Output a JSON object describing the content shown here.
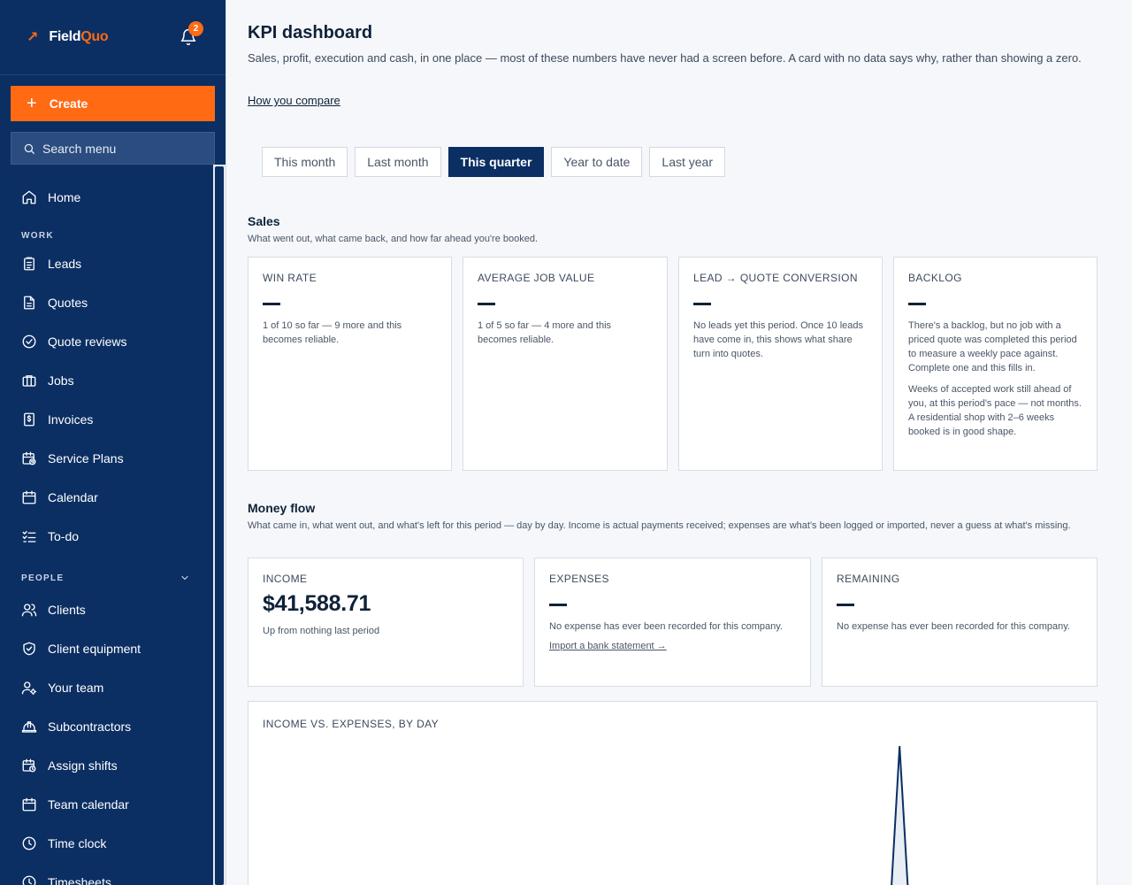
{
  "brand": {
    "name_part1": "Field",
    "name_part2": "Quo",
    "accent": "#ff6a13",
    "sidebar_bg": "#0b2f63"
  },
  "notifications": {
    "count": "2"
  },
  "sidebar": {
    "create_label": "Create",
    "search_label": "Search menu",
    "home": "Home",
    "work_label": "WORK",
    "work_items": [
      "Leads",
      "Quotes",
      "Quote reviews",
      "Jobs",
      "Invoices",
      "Service Plans",
      "Calendar",
      "To-do"
    ],
    "people_label": "PEOPLE",
    "people_items": [
      "Clients",
      "Client equipment",
      "Your team",
      "Subcontractors",
      "Assign shifts",
      "Team calendar",
      "Time clock",
      "Timesheets"
    ]
  },
  "page": {
    "title": "KPI dashboard",
    "subtitle": "Sales, profit, execution and cash, in one place — most of these numbers have never had a screen before. A card with no data says why, rather than showing a zero.",
    "compare_link": "How you compare"
  },
  "periods": {
    "tabs": [
      "This month",
      "Last month",
      "This quarter",
      "Year to date",
      "Last year"
    ],
    "active": "This quarter"
  },
  "sales": {
    "title": "Sales",
    "description": "What went out, what came back, and how far ahead you're booked.",
    "cards": [
      {
        "label": "WIN RATE",
        "value": "—",
        "text": [
          "1 of 10 so far — 9 more and this becomes reliable."
        ]
      },
      {
        "label": "AVERAGE JOB VALUE",
        "value": "—",
        "text": [
          "1 of 5 so far — 4 more and this becomes reliable."
        ]
      },
      {
        "label": "LEAD → QUOTE CONVERSION",
        "value": "—",
        "text": [
          "No leads yet this period. Once 10 leads have come in, this shows what share turn into quotes."
        ]
      },
      {
        "label": "BACKLOG",
        "value": "—",
        "text": [
          "There's a backlog, but no job with a priced quote was completed this period to measure a weekly pace against. Complete one and this fills in.",
          "Weeks of accepted work still ahead of you, at this period's pace — not months. A residential shop with 2–6 weeks booked is in good shape."
        ]
      }
    ]
  },
  "money_flow": {
    "title": "Money flow",
    "description": "What came in, what went out, and what's left for this period — day by day. Income is actual payments received; expenses are what's been logged or imported, never a guess at what's missing.",
    "cards": [
      {
        "label": "INCOME",
        "value": "$41,588.71",
        "text": "Up from nothing last period"
      },
      {
        "label": "EXPENSES",
        "value": "—",
        "text": "No expense has ever been recorded for this company.",
        "link": "Import a bank statement →"
      },
      {
        "label": "REMAINING",
        "value": "—",
        "text": "No expense has ever been recorded for this company."
      }
    ]
  },
  "chart_data": {
    "type": "line",
    "title": "INCOME VS. EXPENSES, BY DAY",
    "series": [
      {
        "values": [
          0,
          0,
          0,
          0,
          0,
          0,
          0,
          0,
          0,
          0,
          0,
          0,
          0,
          0,
          0,
          0,
          0,
          0,
          0,
          0,
          0,
          0,
          0,
          0,
          0,
          0,
          0,
          0,
          0,
          0,
          0,
          0,
          0,
          0,
          0,
          0,
          0,
          0,
          0,
          0,
          0,
          0,
          0,
          0,
          0,
          0,
          0,
          0,
          0,
          0,
          0,
          0,
          0,
          0,
          0,
          0,
          0,
          0,
          0,
          0,
          0,
          0,
          0,
          0,
          0,
          0,
          0,
          0,
          0,
          41588.71,
          0,
          0,
          0,
          0,
          0,
          0,
          0,
          0,
          0,
          0,
          0,
          0,
          0,
          0,
          0,
          0,
          0,
          0,
          0,
          0
        ],
        "color": "#0b2f63"
      }
    ]
  }
}
